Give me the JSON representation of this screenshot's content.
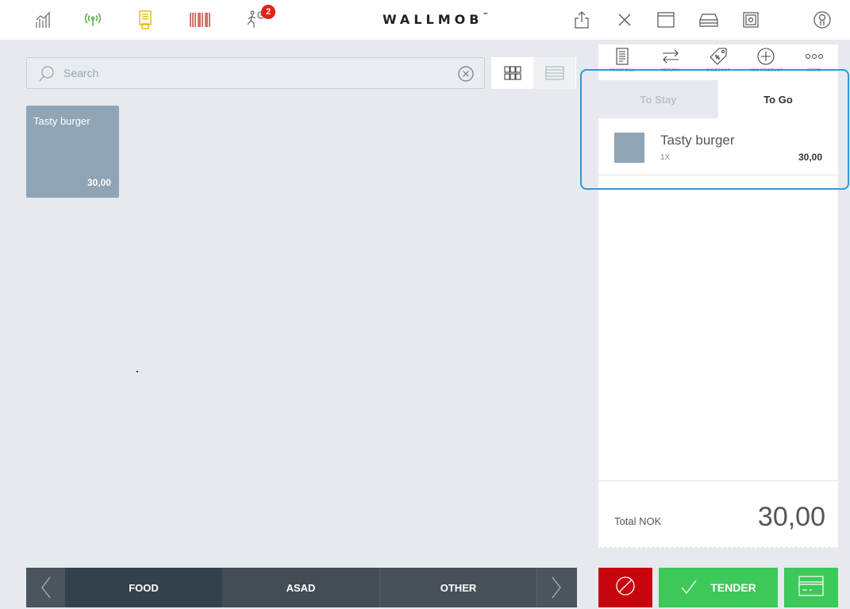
{
  "header": {
    "brand": "WALLMOB",
    "brand_tm": "™",
    "notification_count": "2",
    "icons_left": [
      "stats-icon",
      "wireless-icon",
      "receipt-printer-icon",
      "barcode-icon",
      "runner-clock-icon"
    ],
    "icons_right": [
      "share-icon",
      "close-icon",
      "window-icon",
      "cash-drawer-icon",
      "safe-icon",
      "user-icon"
    ]
  },
  "search": {
    "placeholder": "Search",
    "value": ""
  },
  "products": [
    {
      "name": "Tasty burger",
      "price": "30,00"
    }
  ],
  "categories": [
    "FOOD",
    "ASAD",
    "OTHER"
  ],
  "actions": [
    {
      "label": "PRINT BILL",
      "icon": "print-bill-icon"
    },
    {
      "label": "RETURN",
      "icon": "return-icon"
    },
    {
      "label": "DISCOUNT",
      "icon": "discount-tag-icon"
    },
    {
      "label": "ADD PRODUCT",
      "icon": "add-product-icon"
    },
    {
      "label": "MORE",
      "icon": "more-icon"
    }
  ],
  "order": {
    "tabs": [
      "To Stay",
      "To Go"
    ],
    "active_tab": "To Go",
    "lines": [
      {
        "name": "Tasty burger",
        "qty": "1X",
        "price": "30,00"
      }
    ],
    "total_label": "Total NOK",
    "total_value": "30,00"
  },
  "buttons": {
    "tender": "TENDER"
  },
  "colors": {
    "void": "#c8050f",
    "tender": "#3dc85a",
    "tile": "#8fa4b4",
    "highlight": "#2c9ad6"
  }
}
